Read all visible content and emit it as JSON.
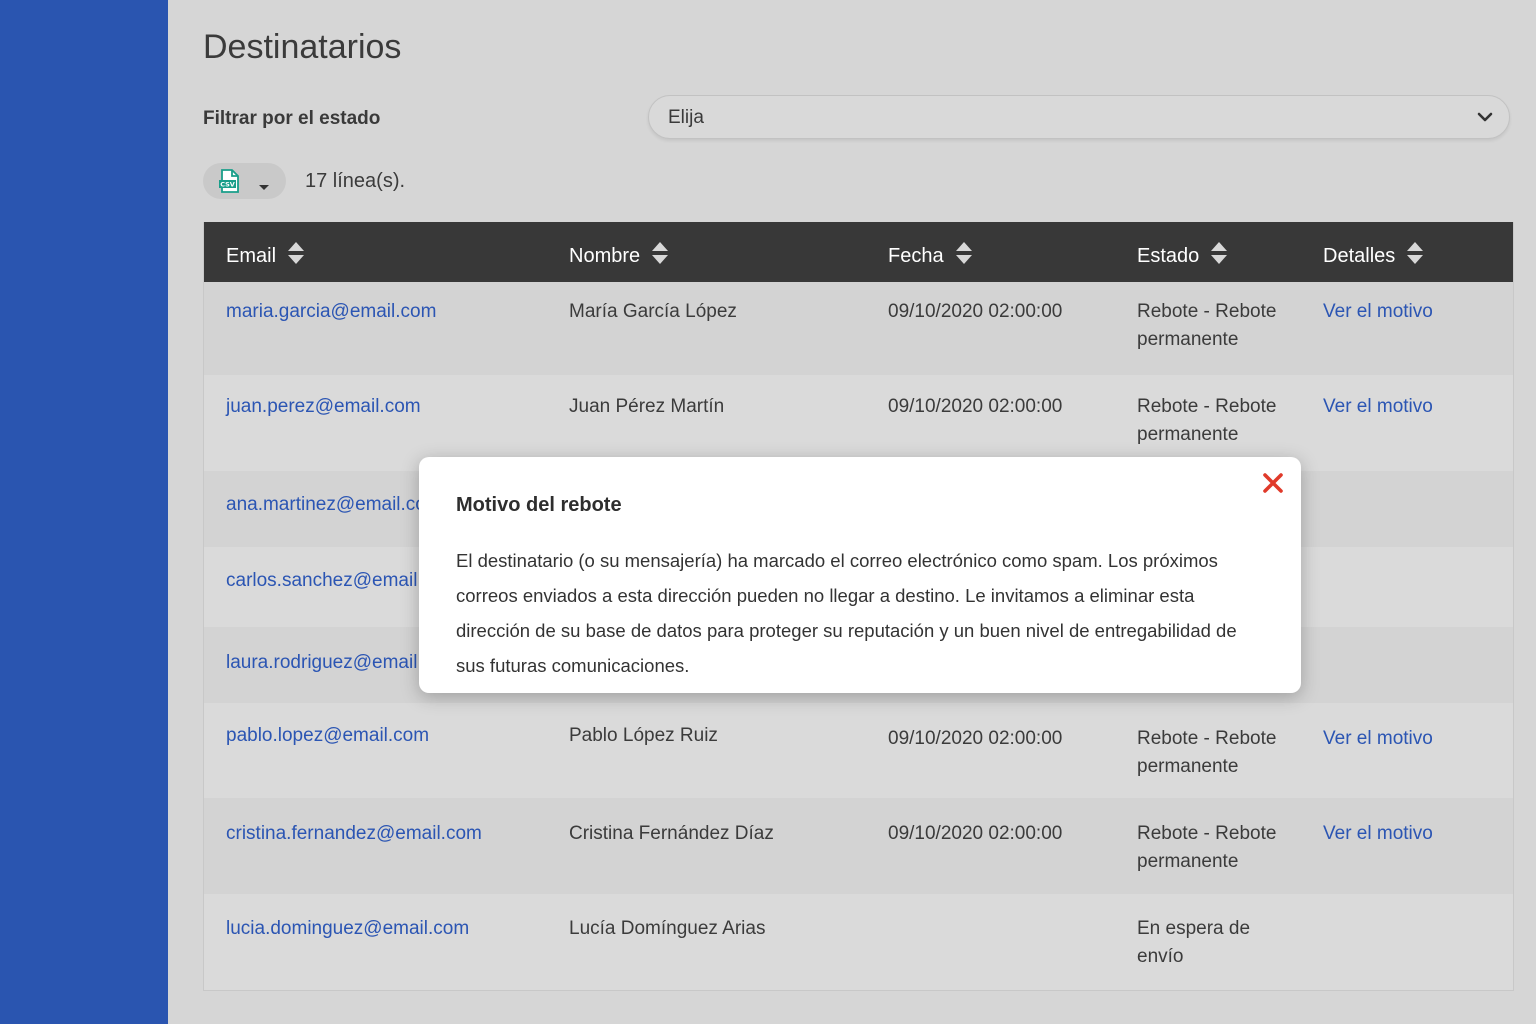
{
  "page": {
    "title": "Destinatarios",
    "filter_label": "Filtrar por el estado",
    "filter_value": "Elija",
    "row_count": "17 línea(s)."
  },
  "export": {
    "icon": "csv-file-icon",
    "accent": "#1a9e8a"
  },
  "table": {
    "columns": [
      "Email",
      "Nombre",
      "Fecha",
      "Estado",
      "Detalles"
    ],
    "rows": [
      {
        "email": "maria.garcia@email.com",
        "name": "María García López",
        "date": "09/10/2020 02:00:00",
        "status": [
          "Rebote - Rebote",
          "permanente"
        ],
        "details": "Ver el motivo"
      },
      {
        "email": "juan.perez@email.com",
        "name": "Juan Pérez Martín",
        "date": "09/10/2020 02:00:00",
        "status": [
          "Rebote - Rebote",
          "permanente"
        ],
        "details": "Ver el motivo"
      },
      {
        "email": "ana.martinez@email.com",
        "name": "",
        "date": "",
        "status": [
          "",
          ""
        ],
        "details": ""
      },
      {
        "email": "carlos.sanchez@email.com",
        "name": "",
        "date": "",
        "status": [
          "",
          ""
        ],
        "details": ""
      },
      {
        "email": "laura.rodriguez@email.com",
        "name": "",
        "date": "",
        "status": [
          "",
          ""
        ],
        "details": ""
      },
      {
        "email": "pablo.lopez@email.com",
        "name": "Pablo López Ruiz",
        "date": "09/10/2020 02:00:00",
        "status": [
          "Rebote - Rebote",
          "permanente"
        ],
        "details": "Ver el motivo"
      },
      {
        "email": "cristina.fernandez@email.com",
        "name": "Cristina Fernández Díaz",
        "date": "09/10/2020 02:00:00",
        "status": [
          "Rebote - Rebote",
          "permanente"
        ],
        "details": "Ver el motivo"
      },
      {
        "email": "lucia.dominguez@email.com",
        "name": "Lucía Domínguez Arias",
        "date": "",
        "status": [
          "En espera de",
          "envío"
        ],
        "details": ""
      }
    ]
  },
  "modal": {
    "title": "Motivo del rebote",
    "body": "El destinatario (o su mensajería) ha marcado el correo electrónico como spam. Los próximos correos enviados a esta dirección pueden no llegar a destino. Le invitamos a eliminar esta dirección de su base de datos para proteger su reputación y un buen nivel de entregabilidad de sus futuras comunicaciones.",
    "close_icon": "close-icon",
    "close_color": "#e03a2a"
  },
  "colors": {
    "sidebar": "#2a55b0",
    "link": "#2b55b3",
    "header": "#383838"
  }
}
